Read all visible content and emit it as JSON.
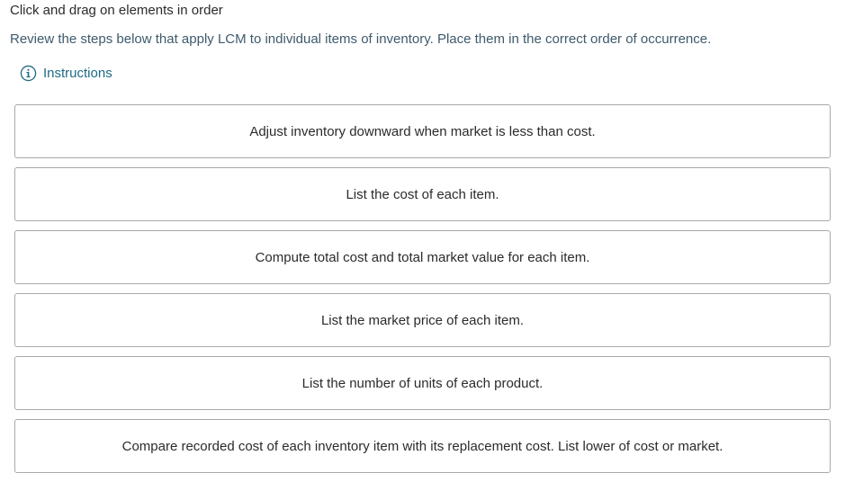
{
  "header": {
    "title": "Click and drag on elements in order"
  },
  "prompt": {
    "text": "Review the steps below that apply LCM to individual items of inventory. Place them in the correct order of occurrence."
  },
  "instructions": {
    "label": "Instructions",
    "icon": "info-icon",
    "color": "#1f6a83"
  },
  "items": [
    {
      "label": "Adjust inventory downward when market is less than cost."
    },
    {
      "label": "List the cost of each item."
    },
    {
      "label": "Compute total cost and total market value for each item."
    },
    {
      "label": "List the market price of each item."
    },
    {
      "label": "List the number of units of each product."
    },
    {
      "label": "Compare recorded cost of each inventory item with its replacement cost. List lower of cost or market."
    }
  ]
}
